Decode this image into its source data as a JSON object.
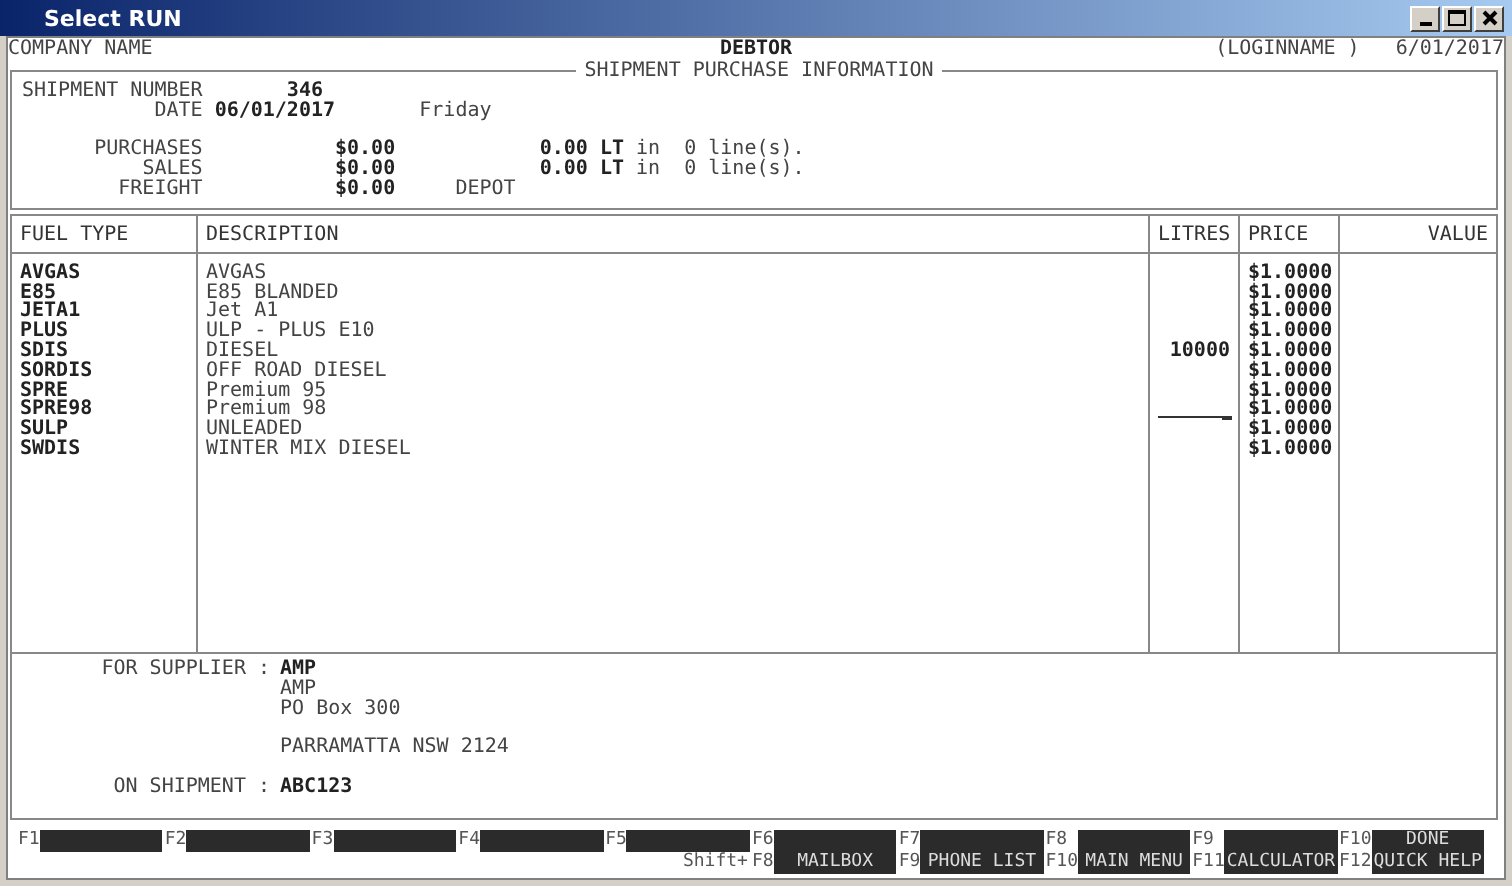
{
  "window": {
    "title": "Select RUN"
  },
  "header": {
    "company": "COMPANY NAME",
    "module": "DEBTOR",
    "user": "(LOGINNAME )",
    "date": "6/01/2017"
  },
  "shipment": {
    "title": "SHIPMENT PURCHASE INFORMATION",
    "number_label": "SHIPMENT NUMBER",
    "number": "346",
    "date_label": "DATE",
    "date": "06/01/2017",
    "day": "Friday",
    "totals": [
      {
        "kind": "lines",
        "label": "PURCHASES",
        "amount": "$0.00",
        "litres": "0.00 LT",
        "detail": "in  0 line(s)."
      },
      {
        "kind": "lines",
        "label": "SALES",
        "amount": "$0.00",
        "litres": "0.00 LT",
        "detail": "in  0 line(s)."
      },
      {
        "kind": "note",
        "label": "FREIGHT",
        "amount": "$0.00",
        "note": "DEPOT"
      }
    ]
  },
  "table": {
    "columns": [
      "FUEL TYPE",
      "DESCRIPTION",
      "LITRES",
      "PRICE",
      "VALUE"
    ],
    "rows": [
      {
        "fuel_type": "AVGAS",
        "description": "AVGAS",
        "price": "$1.0000",
        "editing": false
      },
      {
        "fuel_type": "E85",
        "description": "E85 BLANDED",
        "price": "$1.0000",
        "editing": false
      },
      {
        "fuel_type": "JETA1",
        "description": "Jet A1",
        "price": "$1.0000",
        "editing": false
      },
      {
        "fuel_type": "PLUS",
        "description": "ULP - PLUS E10",
        "price": "$1.0000",
        "editing": false
      },
      {
        "fuel_type": "SDIS",
        "description": "DIESEL",
        "litres": "10000",
        "price": "$1.0000",
        "editing": false
      },
      {
        "fuel_type": "SORDIS",
        "description": "OFF ROAD DIESEL",
        "price": "$1.0000",
        "editing": false
      },
      {
        "fuel_type": "SPRE",
        "description": "Premium 95",
        "price": "$1.0000",
        "editing": false
      },
      {
        "fuel_type": "SPRE98",
        "description": "Premium 98",
        "price": "$1.0000",
        "editing": true
      },
      {
        "fuel_type": "SULP",
        "description": "UNLEADED",
        "price": "$1.0000",
        "editing": false
      },
      {
        "fuel_type": "SWDIS",
        "description": "WINTER MIX DIESEL",
        "price": "$1.0000",
        "editing": false
      }
    ]
  },
  "supplier": {
    "label": "FOR SUPPLIER :",
    "code": "AMP",
    "name": "AMP",
    "address": "PO Box 300",
    "city": "PARRAMATTA NSW  2124",
    "shipment_label": "ON SHIPMENT :",
    "shipment": "ABC123"
  },
  "function_keys": {
    "shift_label": "Shift+",
    "keys": [
      {
        "key": "F1"
      },
      {
        "key": "F2"
      },
      {
        "key": "F3"
      },
      {
        "key": "F4"
      },
      {
        "key": "F5"
      },
      {
        "key": "F6",
        "shift_key": "F8",
        "shift_label": "MAILBOX"
      },
      {
        "key": "F7",
        "shift_key": "F9",
        "shift_label": "PHONE LIST"
      },
      {
        "key": "F8",
        "shift_key": "F10",
        "shift_label": "MAIN MENU"
      },
      {
        "key": "F9",
        "shift_key": "F11",
        "shift_label": "CALCULATOR"
      },
      {
        "key": "F10",
        "label": "DONE",
        "shift_key": "F12",
        "shift_label": "QUICK HELP"
      }
    ]
  }
}
